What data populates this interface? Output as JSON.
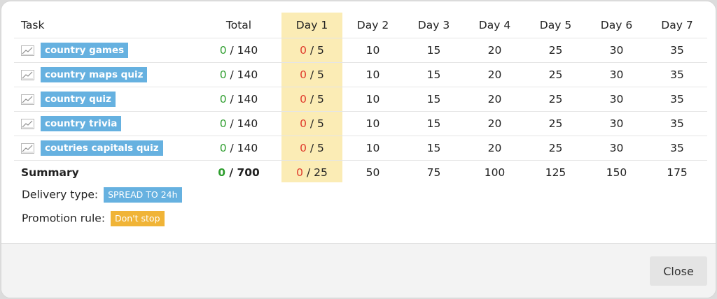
{
  "colors": {
    "tag_blue": "#66b1e0",
    "day_highlight": "#fbecb5",
    "done_green": "#2f9e2f",
    "current_red": "#e03b2c",
    "promotion_orange": "#f0b437"
  },
  "table": {
    "headers": [
      "Task",
      "Total",
      "Day 1",
      "Day 2",
      "Day 3",
      "Day 4",
      "Day 5",
      "Day 6",
      "Day 7"
    ],
    "rows": [
      {
        "task": "country games",
        "total_done": "0",
        "total_rest": " / 140",
        "day1_done": "0",
        "day1_rest": " / 5",
        "days": [
          "10",
          "15",
          "20",
          "25",
          "30",
          "35"
        ]
      },
      {
        "task": "country maps quiz",
        "total_done": "0",
        "total_rest": " / 140",
        "day1_done": "0",
        "day1_rest": " / 5",
        "days": [
          "10",
          "15",
          "20",
          "25",
          "30",
          "35"
        ]
      },
      {
        "task": "country quiz",
        "total_done": "0",
        "total_rest": " / 140",
        "day1_done": "0",
        "day1_rest": " / 5",
        "days": [
          "10",
          "15",
          "20",
          "25",
          "30",
          "35"
        ]
      },
      {
        "task": "country trivia",
        "total_done": "0",
        "total_rest": " / 140",
        "day1_done": "0",
        "day1_rest": " / 5",
        "days": [
          "10",
          "15",
          "20",
          "25",
          "30",
          "35"
        ]
      },
      {
        "task": "coutries capitals quiz",
        "total_done": "0",
        "total_rest": " / 140",
        "day1_done": "0",
        "day1_rest": " / 5",
        "days": [
          "10",
          "15",
          "20",
          "25",
          "30",
          "35"
        ]
      }
    ],
    "summary": {
      "label": "Summary",
      "total_done": "0",
      "total_rest": " / 700",
      "day1_done": "0",
      "day1_rest": " / 25",
      "days": [
        "50",
        "75",
        "100",
        "125",
        "150",
        "175"
      ]
    }
  },
  "delivery": {
    "label": "Delivery type:",
    "value": "SPREAD TO 24h"
  },
  "promotion": {
    "label": "Promotion rule:",
    "value": "Don't stop"
  },
  "footer": {
    "close_label": "Close"
  },
  "icons": {
    "row_icon": "line-chart-icon"
  }
}
